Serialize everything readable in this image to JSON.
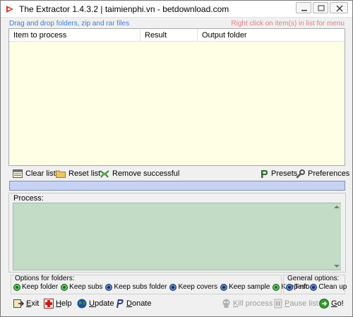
{
  "window": {
    "title": "The Extractor 1.4.3.2 | taimienphi.vn - betdownload.com"
  },
  "hints": {
    "left": "Drag and drop folders, zip and rar files",
    "right": "Right click on item(s) in list for menu"
  },
  "list": {
    "columns": [
      "Item to process",
      "Result",
      "Output folder"
    ],
    "rows": []
  },
  "toolbar": {
    "clear_list": "Clear list",
    "reset_list": "Reset list",
    "remove_successful": "Remove successful",
    "presets": "Presets",
    "preferences": "Preferences"
  },
  "progress": {
    "value": 0
  },
  "process": {
    "label": "Process:",
    "text": ""
  },
  "options_folders": {
    "title": "Options for folders:",
    "items": [
      {
        "label": "Keep folder",
        "state": "on"
      },
      {
        "label": "Keep subs",
        "state": "on"
      },
      {
        "label": "Keep subs folder",
        "state": "off"
      },
      {
        "label": "Keep covers",
        "state": "off"
      },
      {
        "label": "Keep sample",
        "state": "off"
      },
      {
        "label": "Keep nfo",
        "state": "on"
      }
    ]
  },
  "options_general": {
    "title": "General options:",
    "items": [
      {
        "label": "Test",
        "state": "off"
      },
      {
        "label": "Clean up",
        "state": "off"
      }
    ]
  },
  "buttons": {
    "exit": {
      "label": "Exit",
      "accel": "E",
      "rest": "xit"
    },
    "help": {
      "label": "Help",
      "accel": "H",
      "rest": "elp"
    },
    "update": {
      "label": "Update",
      "accel": "U",
      "rest": "pdate"
    },
    "donate": {
      "label": "Donate",
      "accel": "D",
      "rest": "onate"
    },
    "kill": {
      "label": "Kill process",
      "accel": "K",
      "rest": "ill process"
    },
    "pause": {
      "label": "Pause list",
      "accel": "P",
      "rest": "ause list"
    },
    "go": {
      "label": "Go!",
      "accel": "G",
      "rest": "o!"
    }
  },
  "colors": {
    "list_bg": "#ffffe6",
    "process_bg": "#c2dcc6",
    "progress_bg": "#c7d3f5",
    "hint_left": "#3d7fd6",
    "hint_right": "#e07e85"
  }
}
